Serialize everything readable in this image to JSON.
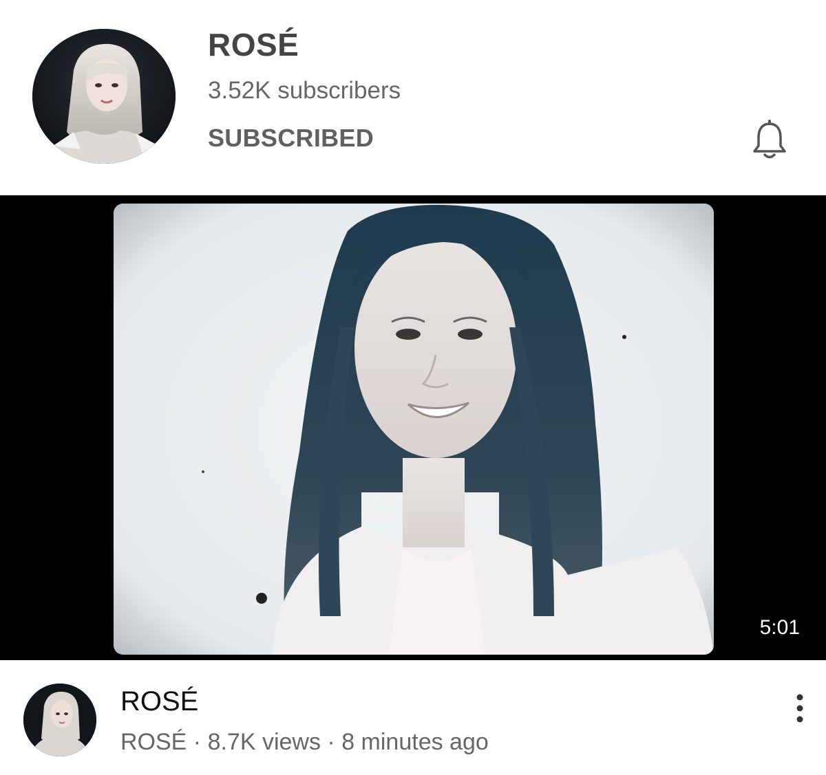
{
  "channel": {
    "name": "ROSÉ",
    "subscribers": "3.52K subscribers",
    "subscribe_state": "SUBSCRIBED",
    "avatar_icon": "channel-avatar-photo",
    "bell_icon": "bell-icon"
  },
  "video": {
    "duration": "5:01",
    "title": "ROSÉ",
    "channel_name": "ROSÉ",
    "separator": " · ",
    "views": "8.7K views",
    "uploaded": "8 minutes ago",
    "more_icon": "more-vert-icon"
  },
  "colors": {
    "title_text": "#444444",
    "secondary_text": "#666666",
    "thumbnail_bg": "#000000"
  }
}
